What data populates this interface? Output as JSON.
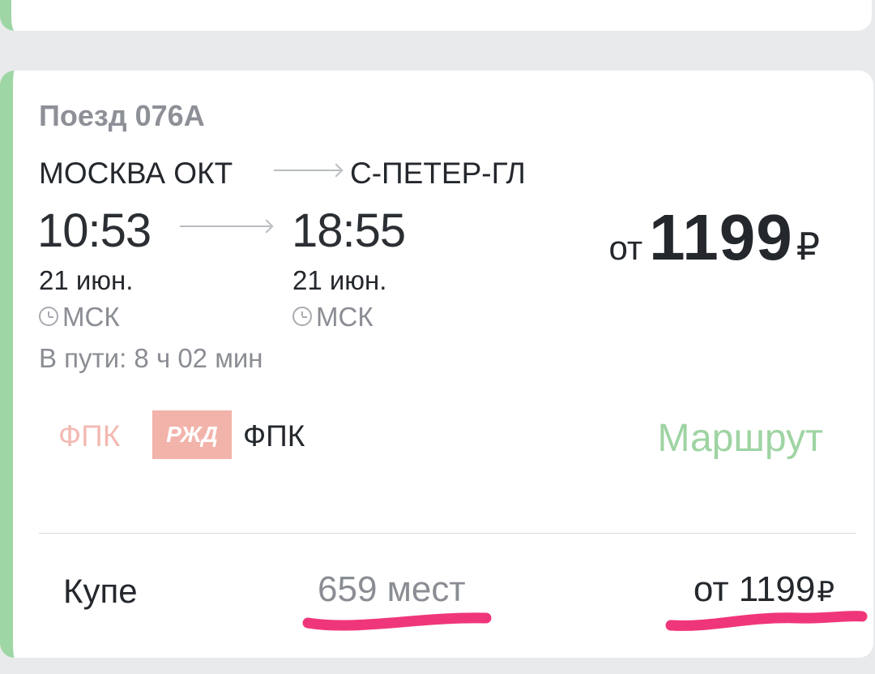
{
  "train": {
    "title": "Поезд 076А",
    "from_station": "МОСКВА ОКТ",
    "to_station": "С-ПЕТЕР-ГЛ",
    "departure_time": "10:53",
    "arrival_time": "18:55",
    "departure_date": "21 июн.",
    "arrival_date": "21 июн.",
    "departure_tz": "МСК",
    "arrival_tz": "МСК",
    "duration": "В пути: 8 ч 02 мин"
  },
  "price": {
    "prefix": "от",
    "amount": "1199",
    "currency": "₽"
  },
  "carrier": {
    "faded_name": "ФПК",
    "logo_text": "РЖД",
    "name": "ФПК",
    "route_link": "Маршрут"
  },
  "class_row": {
    "name": "Купе",
    "seats": "659 мест",
    "price_prefix": "от",
    "price_amount": "1199",
    "currency": "₽"
  },
  "colors": {
    "accent_green": "#9fd6a5",
    "route_link": "#9ed4a3",
    "highlight_marker": "#f0367a",
    "logo_red": "#f2b3aa"
  }
}
